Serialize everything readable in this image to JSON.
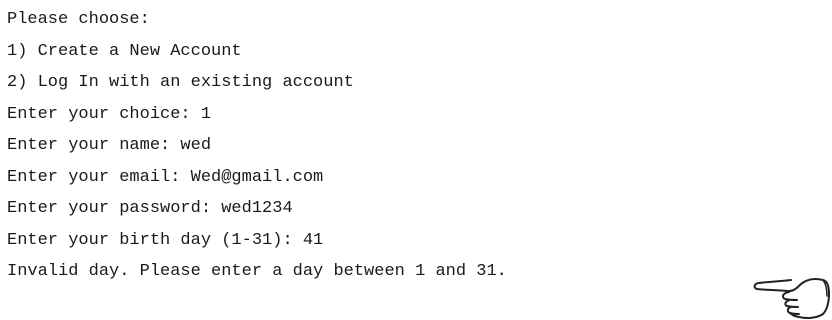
{
  "console": {
    "lines": [
      "Please choose:",
      "1) Create a New Account",
      "2) Log In with an existing account",
      "Enter your choice: 1",
      "Enter your name: wed",
      "Enter your email: Wed@gmail.com",
      "Enter your password: wed1234",
      "Enter your birth day (1-31): 41",
      "Invalid day. Please enter a day between 1 and 31."
    ]
  },
  "icons": {
    "pointer": "hand-pointing-left-icon"
  },
  "colors": {
    "background": "#ffffff",
    "text": "#1a1a1a"
  }
}
